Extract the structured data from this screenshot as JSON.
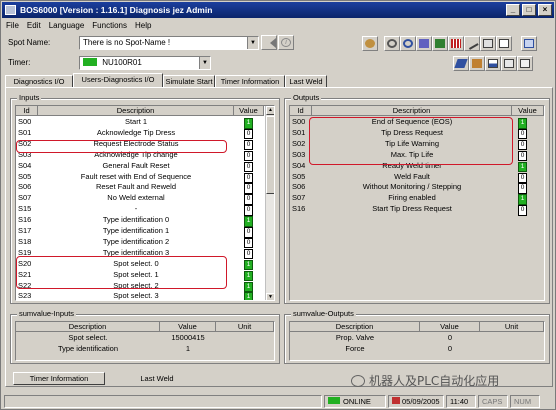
{
  "window": {
    "title": "BOS6000 [Version : 1.16.1] Diagnosis jez Admin"
  },
  "menu": [
    "File",
    "Edit",
    "Language",
    "Functions",
    "Help"
  ],
  "spot_name": {
    "label": "Spot Name:",
    "value": "There is no Spot-Name !"
  },
  "timer": {
    "label": "Timer:",
    "value": "NU100R01"
  },
  "tabs": [
    "Diagnostics I/O",
    "Users-Diagnostics I/O",
    "Simulate Start",
    "Timer Information",
    "Last Weld"
  ],
  "inputs": {
    "title": "Inputs",
    "headers": [
      "Id",
      "Description",
      "Value"
    ],
    "rows": [
      {
        "id": "S00",
        "desc": "Start 1",
        "val": "1"
      },
      {
        "id": "S01",
        "desc": "Acknowledge Tip Dress",
        "val": "0"
      },
      {
        "id": "S02",
        "desc": "Request Electrode Status",
        "val": "0"
      },
      {
        "id": "S03",
        "desc": "Acknowledge Tip change",
        "val": "0"
      },
      {
        "id": "S04",
        "desc": "General Fault Reset",
        "val": "0"
      },
      {
        "id": "S05",
        "desc": "Fault reset with End of Sequence",
        "val": "0"
      },
      {
        "id": "S06",
        "desc": "Reset Fault and Reweld",
        "val": "0"
      },
      {
        "id": "S07",
        "desc": "No Weld external",
        "val": "0"
      },
      {
        "id": "S15",
        "desc": "-",
        "val": "0"
      },
      {
        "id": "S16",
        "desc": "Type identification 0",
        "val": "1"
      },
      {
        "id": "S17",
        "desc": "Type identification 1",
        "val": "0"
      },
      {
        "id": "S18",
        "desc": "Type identification 2",
        "val": "0"
      },
      {
        "id": "S19",
        "desc": "Type identification 3",
        "val": "0"
      },
      {
        "id": "S20",
        "desc": "Spot select. 0",
        "val": "1"
      },
      {
        "id": "S21",
        "desc": "Spot select. 1",
        "val": "1"
      },
      {
        "id": "S22",
        "desc": "Spot select. 2",
        "val": "1"
      },
      {
        "id": "S23",
        "desc": "Spot select. 3",
        "val": "1"
      }
    ]
  },
  "outputs": {
    "title": "Outputs",
    "headers": [
      "Id",
      "Description",
      "Value"
    ],
    "rows": [
      {
        "id": "S00",
        "desc": "End of Sequence (EOS)",
        "val": "1"
      },
      {
        "id": "S01",
        "desc": "Tip Dress Request",
        "val": "0"
      },
      {
        "id": "S02",
        "desc": "Tip Life Warning",
        "val": "0"
      },
      {
        "id": "S03",
        "desc": "Max. Tip Life",
        "val": "0"
      },
      {
        "id": "S04",
        "desc": "Ready Weld timer",
        "val": "1"
      },
      {
        "id": "S05",
        "desc": "Weld Fault",
        "val": "0"
      },
      {
        "id": "S06",
        "desc": "Without Monitoring / Stepping",
        "val": "0"
      },
      {
        "id": "S07",
        "desc": "Firing enabled",
        "val": "1"
      },
      {
        "id": "S16",
        "desc": "Start Tip Dress Request",
        "val": "0"
      }
    ]
  },
  "sum_inputs": {
    "title": "sumvalue-Inputs",
    "headers": [
      "Description",
      "Value",
      "Unit"
    ],
    "rows": [
      {
        "desc": "Spot select.",
        "val": "15000415",
        "unit": ""
      },
      {
        "desc": "Type identification",
        "val": "1",
        "unit": ""
      }
    ]
  },
  "sum_outputs": {
    "title": "sumvalue-Outputs",
    "headers": [
      "Description",
      "Value",
      "Unit"
    ],
    "rows": [
      {
        "desc": "Prop. Valve",
        "val": "0",
        "unit": ""
      },
      {
        "desc": "Force",
        "val": "0",
        "unit": ""
      }
    ]
  },
  "bottom_buttons": [
    "Timer Information",
    "Last Weld"
  ],
  "status": {
    "online": "ONLINE",
    "date": "05/09/2005",
    "time": "11:40",
    "caps": "CAPS",
    "num": "NUM"
  },
  "watermark": "机器人及PLC自动化应用",
  "colors": {
    "highlight": "#d0182a",
    "active_value": "#22b022",
    "title_bar": "#0a246a"
  }
}
